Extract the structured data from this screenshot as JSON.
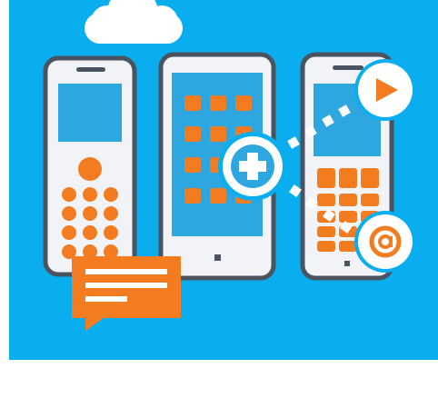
{
  "illustration": {
    "subject": "mobile-phones-with-apps",
    "colors": {
      "sky": "#0AAEEE",
      "screen": "#2EA6DF",
      "phone_body": "#F2F3F7",
      "phone_outline": "#4A5360",
      "accent_orange": "#F47C20",
      "white": "#FFFFFF",
      "page_background": "#FFFFFF"
    },
    "icons": [
      "cloud-icon",
      "keypad-phone-icon",
      "smartphone-app-grid-icon",
      "qwerty-phone-icon",
      "plus-bubble-icon",
      "play-bubble-icon",
      "at-sign-bubble-icon",
      "chat-message-icon"
    ]
  }
}
